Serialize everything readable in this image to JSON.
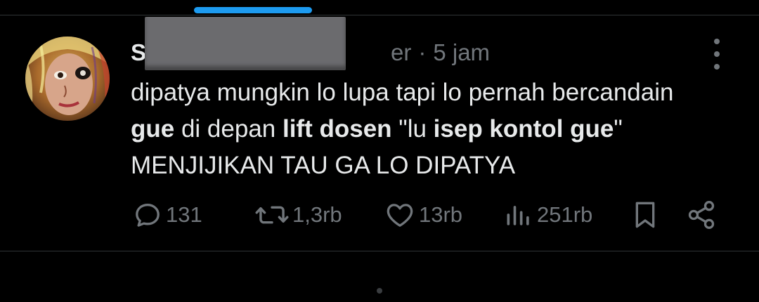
{
  "tweet": {
    "author_name_visible": "S",
    "author_handle_visible_tail": "er",
    "separator": "·",
    "timestamp": "5 jam",
    "text_segments": [
      {
        "text": "dipatya mungkin lo lupa tapi lo pernah bercandain ",
        "bold": false
      },
      {
        "text": "gue",
        "bold": true
      },
      {
        "text": " di depan ",
        "bold": false
      },
      {
        "text": "lift dosen",
        "bold": true
      },
      {
        "text": " \"lu ",
        "bold": false
      },
      {
        "text": "isep kontol gue",
        "bold": true
      },
      {
        "text": "\" MENJIJIKAN TAU GA LO DIPATYA",
        "bold": false
      }
    ]
  },
  "actions": {
    "reply": {
      "icon": "reply-icon",
      "count": "131"
    },
    "retweet": {
      "icon": "retweet-icon",
      "count": "1,3rb"
    },
    "like": {
      "icon": "heart-icon",
      "count": "13rb"
    },
    "views": {
      "icon": "views-icon",
      "count": "251rb"
    },
    "bookmark": {
      "icon": "bookmark-icon"
    },
    "share": {
      "icon": "share-icon"
    }
  },
  "colors": {
    "background": "#000000",
    "text_primary": "#e7e9ea",
    "text_secondary": "#71767b",
    "accent": "#1d9bf0",
    "divider": "#2f3336",
    "redaction": "#6b6b6e"
  }
}
